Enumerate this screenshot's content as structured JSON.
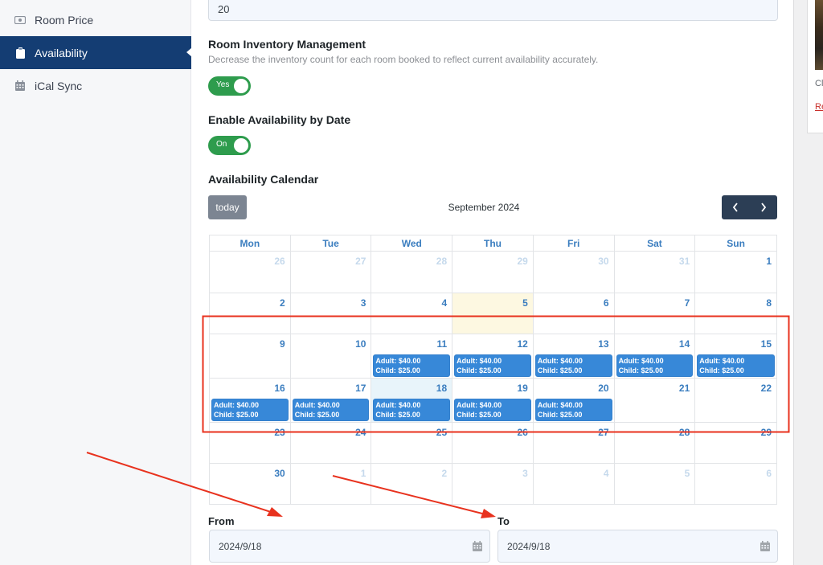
{
  "sidebar": {
    "items": [
      {
        "label": "Room Price",
        "icon": "money-icon",
        "active": false
      },
      {
        "label": "Availability",
        "icon": "clipboard-icon",
        "active": true
      },
      {
        "label": "iCal Sync",
        "icon": "calendar-icon",
        "active": false
      }
    ]
  },
  "main": {
    "top_input_value": "20",
    "inventory": {
      "title": "Room Inventory Management",
      "description": "Decrease the inventory count for each room booked to reflect current availability accurately.",
      "toggle_label": "Yes",
      "enabled": true
    },
    "availability_by_date": {
      "title": "Enable Availability by Date",
      "toggle_label": "On",
      "enabled": true
    },
    "calendar": {
      "title": "Availability Calendar",
      "today_label": "today",
      "month_label": "September 2024",
      "prev_icon": "chevron-left-icon",
      "next_icon": "chevron-right-icon",
      "weekdays": [
        "Mon",
        "Tue",
        "Wed",
        "Thu",
        "Fri",
        "Sat",
        "Sun"
      ],
      "weeks": [
        [
          {
            "d": "26",
            "other": true
          },
          {
            "d": "27",
            "other": true
          },
          {
            "d": "28",
            "other": true
          },
          {
            "d": "29",
            "other": true
          },
          {
            "d": "30",
            "other": true
          },
          {
            "d": "31",
            "other": true
          },
          {
            "d": "1"
          }
        ],
        [
          {
            "d": "2"
          },
          {
            "d": "3"
          },
          {
            "d": "4"
          },
          {
            "d": "5",
            "today": true
          },
          {
            "d": "6"
          },
          {
            "d": "7"
          },
          {
            "d": "8"
          }
        ],
        [
          {
            "d": "9"
          },
          {
            "d": "10"
          },
          {
            "d": "11",
            "event": [
              "Adult: $40.00",
              "Child: $25.00"
            ]
          },
          {
            "d": "12",
            "event": [
              "Adult: $40.00",
              "Child: $25.00"
            ]
          },
          {
            "d": "13",
            "event": [
              "Adult: $40.00",
              "Child: $25.00"
            ]
          },
          {
            "d": "14",
            "event": [
              "Adult: $40.00",
              "Child: $25.00"
            ]
          },
          {
            "d": "15",
            "event": [
              "Adult: $40.00",
              "Child: $25.00"
            ]
          }
        ],
        [
          {
            "d": "16",
            "event": [
              "Adult: $40.00",
              "Child: $25.00"
            ]
          },
          {
            "d": "17",
            "event": [
              "Adult: $40.00",
              "Child: $25.00"
            ]
          },
          {
            "d": "18",
            "selected": true,
            "event": [
              "Adult: $40.00",
              "Child: $25.00"
            ]
          },
          {
            "d": "19",
            "event": [
              "Adult: $40.00",
              "Child: $25.00"
            ]
          },
          {
            "d": "20",
            "event": [
              "Adult: $40.00",
              "Child: $25.00"
            ]
          },
          {
            "d": "21"
          },
          {
            "d": "22"
          }
        ],
        [
          {
            "d": "23"
          },
          {
            "d": "24"
          },
          {
            "d": "25"
          },
          {
            "d": "26"
          },
          {
            "d": "27"
          },
          {
            "d": "28"
          },
          {
            "d": "29"
          }
        ],
        [
          {
            "d": "30"
          },
          {
            "d": "1",
            "other": true
          },
          {
            "d": "2",
            "other": true
          },
          {
            "d": "3",
            "other": true
          },
          {
            "d": "4",
            "other": true
          },
          {
            "d": "5",
            "other": true
          },
          {
            "d": "6",
            "other": true
          }
        ]
      ]
    },
    "from": {
      "label": "From",
      "value": "2024/9/18"
    },
    "to": {
      "label": "To",
      "value": "2024/9/18"
    }
  },
  "right_panel": {
    "caption_partial": "Cl",
    "link_partial": "Re"
  },
  "colors": {
    "sidebar_active": "#143d73",
    "toggle_on": "#2e9c4d",
    "event_bg": "#3788d8",
    "today_bg": "#fdf8e1",
    "annotation": "#e8321e"
  }
}
